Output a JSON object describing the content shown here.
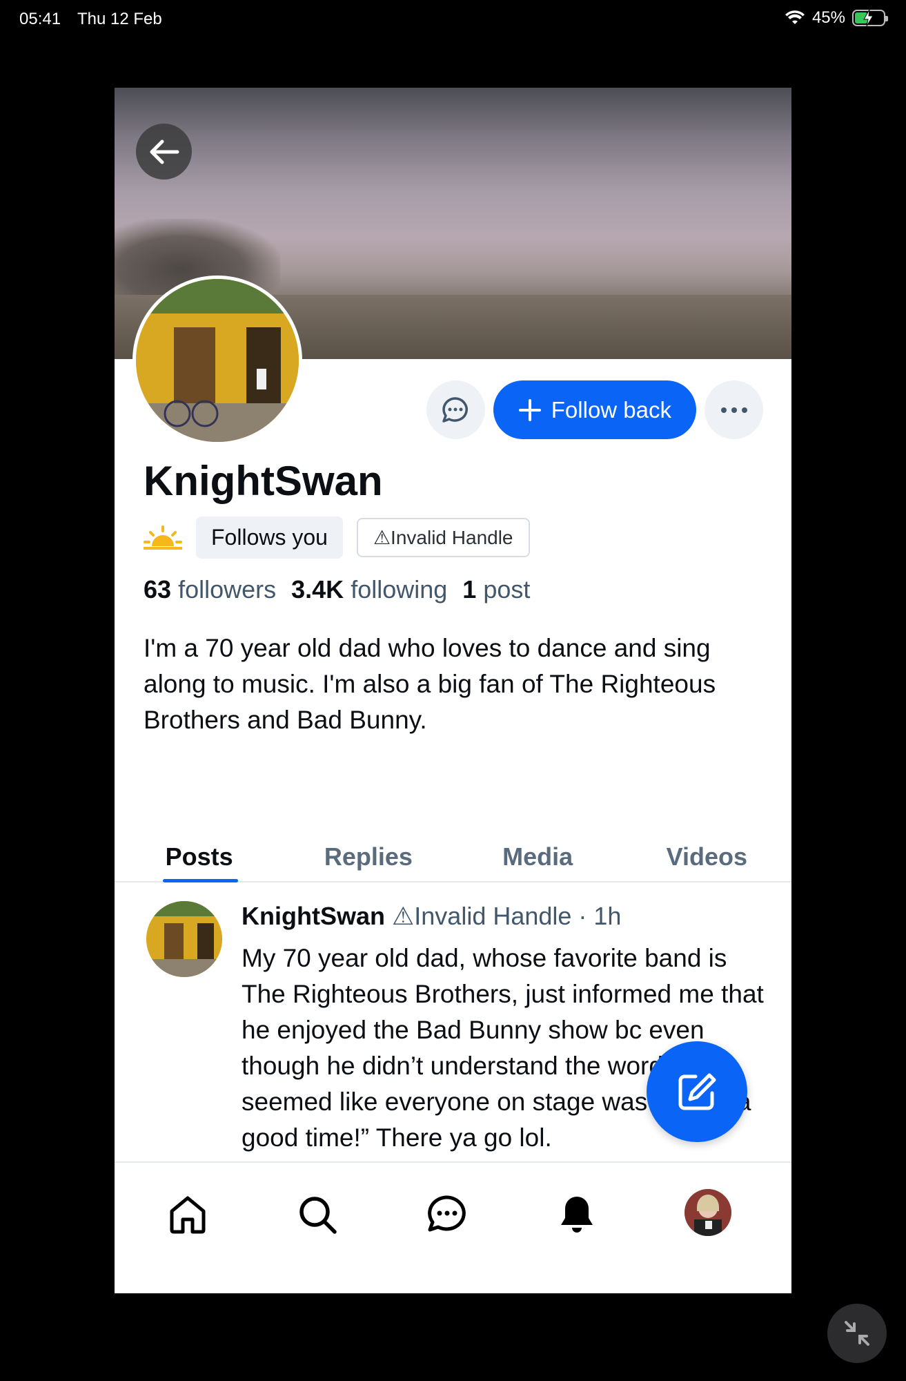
{
  "status_bar": {
    "time": "05:41",
    "date": "Thu 12 Feb",
    "battery": "45%"
  },
  "profile": {
    "display_name": "KnightSwan",
    "follows_you": "Follows you",
    "invalid_handle": "⚠Invalid Handle",
    "follow_button": "Follow back",
    "stats": {
      "followers_count": "63",
      "followers_label": "followers",
      "following_count": "3.4K",
      "following_label": "following",
      "posts_count": "1",
      "posts_label": "post"
    },
    "bio": "I'm a 70 year old dad who loves to dance and sing along to music. I'm also a big fan of The Righteous Brothers and Bad Bunny."
  },
  "tabs": [
    {
      "label": "Posts",
      "active": true
    },
    {
      "label": "Replies",
      "active": false
    },
    {
      "label": "Media",
      "active": false
    },
    {
      "label": "Videos",
      "active": false
    }
  ],
  "post": {
    "author": "KnightSwan",
    "handle_warning": "⚠Invalid Handle",
    "time": " · 1h",
    "text": "My 70 year old dad, whose favorite band is The Righteous Brothers, just informed me that he enjoyed the Bad Bunny show bc even though he didn’t understand the words, “it seemed like everyone on stage was having a good time!” There ya go lol."
  },
  "colors": {
    "accent": "#0a64f5",
    "secondary_text": "#42576c"
  },
  "icons": {
    "back": "arrow-left-icon",
    "message": "chat-bubble-icon",
    "more": "ellipsis-icon",
    "compose": "edit-icon",
    "nav": [
      "home-icon",
      "search-icon",
      "chat-icon",
      "bell-icon"
    ]
  }
}
